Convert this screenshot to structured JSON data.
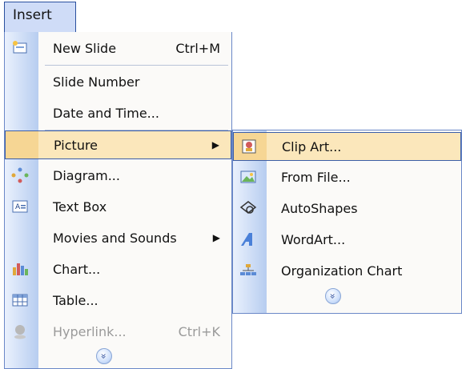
{
  "menubar": {
    "insert_label": "Insert"
  },
  "insert_menu": {
    "items": [
      {
        "label": "New Slide",
        "shortcut": "Ctrl+M",
        "icon": "new-slide-icon"
      },
      {
        "label": "Slide Number"
      },
      {
        "label": "Date and Time..."
      },
      {
        "label": "Picture",
        "submenu": "▶",
        "highlighted": true
      },
      {
        "label": "Diagram...",
        "icon": "diagram-icon"
      },
      {
        "label": "Text Box",
        "icon": "text-box-icon"
      },
      {
        "label": "Movies and Sounds",
        "submenu": "▶"
      },
      {
        "label": "Chart...",
        "icon": "chart-icon"
      },
      {
        "label": "Table...",
        "icon": "table-icon"
      },
      {
        "label": "Hyperlink...",
        "shortcut": "Ctrl+K",
        "disabled": true,
        "icon": "hyperlink-icon"
      }
    ],
    "expand_glyph": "»"
  },
  "picture_menu": {
    "items": [
      {
        "label": "Clip Art...",
        "icon": "clip-art-icon",
        "highlighted": true
      },
      {
        "label": "From File...",
        "icon": "from-file-icon"
      },
      {
        "label": "AutoShapes",
        "icon": "autoshapes-icon"
      },
      {
        "label": "WordArt...",
        "icon": "wordart-icon"
      },
      {
        "label": "Organization Chart",
        "icon": "org-chart-icon"
      }
    ],
    "expand_glyph": "»"
  },
  "colors": {
    "highlight": "#fbe7bb",
    "border": "#3b5ea8",
    "gutter": "#b7cdf0"
  }
}
